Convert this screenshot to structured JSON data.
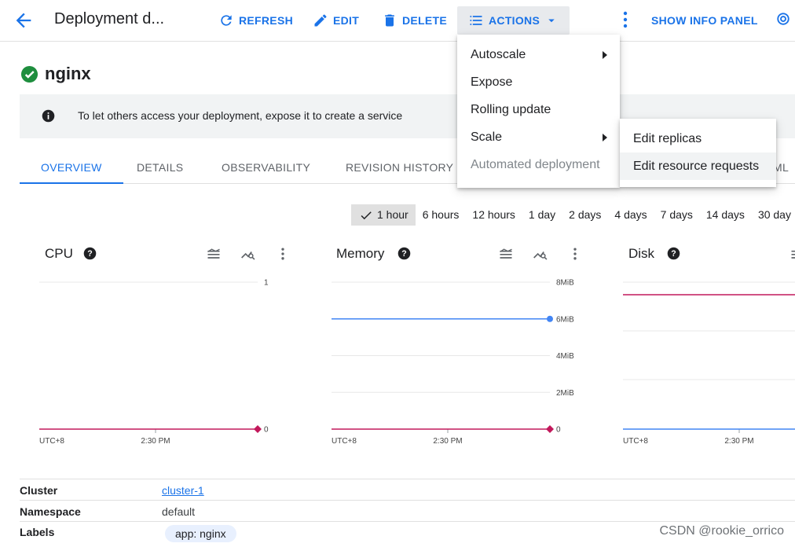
{
  "header": {
    "title": "Deployment d...",
    "refresh_label": "REFRESH",
    "edit_label": "EDIT",
    "delete_label": "DELETE",
    "actions_label": "ACTIONS",
    "info_panel_label": "SHOW INFO PANEL"
  },
  "resource": {
    "name": "nginx",
    "status": "ok"
  },
  "banner": {
    "text": "To let others access your deployment, expose it to create a service"
  },
  "tabs": [
    {
      "label": "OVERVIEW",
      "active": true
    },
    {
      "label": "DETAILS",
      "active": false
    },
    {
      "label": "OBSERVABILITY",
      "active": false
    },
    {
      "label": "REVISION HISTORY",
      "active": false
    },
    {
      "label": "ML",
      "active": false
    }
  ],
  "time_range": {
    "options": [
      "1 hour",
      "6 hours",
      "12 hours",
      "1 day",
      "2 days",
      "4 days",
      "7 days",
      "14 days",
      "30 day"
    ],
    "selected": "1 hour"
  },
  "charts": [
    {
      "title": "CPU",
      "y_ticks": [
        "1",
        "0"
      ],
      "x_ticks": [
        "UTC+8",
        "2:30 PM"
      ]
    },
    {
      "title": "Memory",
      "y_ticks": [
        "8MiB",
        "6MiB",
        "4MiB",
        "2MiB",
        "0"
      ],
      "x_ticks": [
        "UTC+8",
        "2:30 PM"
      ]
    },
    {
      "title": "Disk",
      "y_ticks": [],
      "x_ticks": [
        "UTC+8",
        "2:30 PM"
      ]
    }
  ],
  "chart_data": [
    {
      "type": "line",
      "title": "CPU",
      "ylim": [
        0,
        1
      ],
      "series": [
        {
          "values": [
            0,
            0
          ],
          "color": "#c2185b"
        }
      ]
    },
    {
      "type": "line",
      "title": "Memory",
      "ylim": [
        0,
        8
      ],
      "yunit": "MiB",
      "series": [
        {
          "values": [
            6,
            6
          ],
          "color": "#4285f4"
        },
        {
          "values": [
            0,
            0
          ],
          "color": "#c2185b"
        }
      ]
    },
    {
      "type": "line",
      "title": "Disk",
      "series": [
        {
          "values": [],
          "color": "#c2185b"
        },
        {
          "values": [],
          "color": "#4285f4"
        }
      ]
    }
  ],
  "properties": [
    {
      "key": "Cluster",
      "value": "cluster-1",
      "type": "link"
    },
    {
      "key": "Namespace",
      "value": "default",
      "type": "text"
    },
    {
      "key": "Labels",
      "value": "app: nginx",
      "type": "chip"
    }
  ],
  "actions_menu": [
    {
      "label": "Autoscale",
      "submenu": true,
      "disabled": false
    },
    {
      "label": "Expose",
      "submenu": false,
      "disabled": false
    },
    {
      "label": "Rolling update",
      "submenu": false,
      "disabled": false
    },
    {
      "label": "Scale",
      "submenu": true,
      "disabled": false
    },
    {
      "label": "Automated deployment",
      "submenu": false,
      "disabled": true
    }
  ],
  "scale_submenu": [
    {
      "label": "Edit replicas"
    },
    {
      "label": "Edit resource requests"
    }
  ],
  "watermark": "CSDN @rookie_orrico",
  "colors": {
    "accent": "#1a73e8",
    "success": "#1e8e3e",
    "series_pink": "#c2185b",
    "series_blue": "#4285f4"
  }
}
